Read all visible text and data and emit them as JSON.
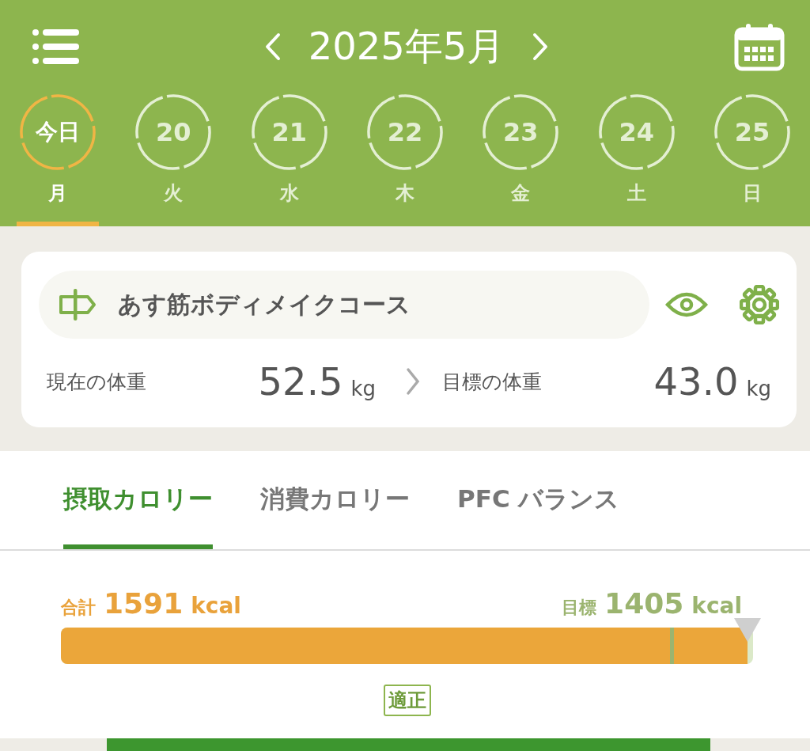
{
  "header": {
    "month": "2025年5月"
  },
  "days": [
    {
      "date": "今日",
      "weekday": "月",
      "selected": true
    },
    {
      "date": "20",
      "weekday": "火",
      "selected": false
    },
    {
      "date": "21",
      "weekday": "水",
      "selected": false
    },
    {
      "date": "22",
      "weekday": "木",
      "selected": false
    },
    {
      "date": "23",
      "weekday": "金",
      "selected": false
    },
    {
      "date": "24",
      "weekday": "土",
      "selected": false
    },
    {
      "date": "25",
      "weekday": "日",
      "selected": false
    }
  ],
  "course": {
    "name": "あす筋ボディメイクコース"
  },
  "weights": {
    "current": {
      "label": "現在の体重",
      "value": "52.5",
      "unit": "kg"
    },
    "target": {
      "label": "目標の体重",
      "value": "43.0",
      "unit": "kg"
    }
  },
  "tabs": [
    {
      "label": "摂取カロリー",
      "selected": true
    },
    {
      "label": "消費カロリー",
      "selected": false
    },
    {
      "label": "PFC バランス",
      "selected": false
    }
  ],
  "calories": {
    "total_label": "合計",
    "total": "1591",
    "total_unit": "kcal",
    "target_label": "目標",
    "target": "1405",
    "target_unit": "kcal",
    "level": 0.992,
    "target_marker": {
      "level": 0.88
    },
    "status": "適正"
  }
}
